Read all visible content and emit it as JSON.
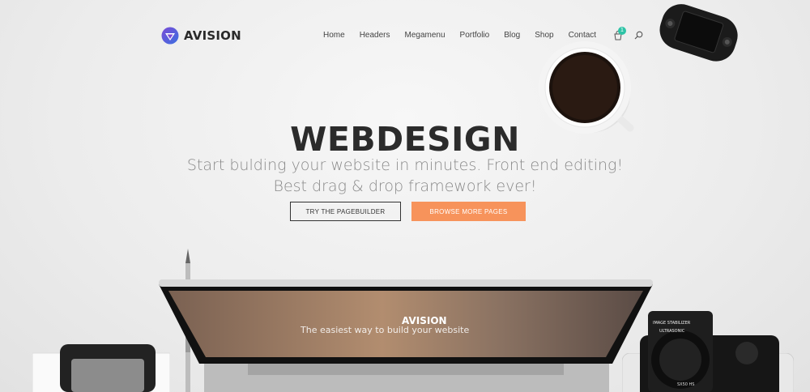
{
  "brand": {
    "name": "AVISION"
  },
  "nav": {
    "items": [
      "Home",
      "Headers",
      "Megamenu",
      "Portfolio",
      "Blog",
      "Shop",
      "Contact"
    ]
  },
  "cart": {
    "count": "1"
  },
  "hero": {
    "title": "WEBDESIGN",
    "subtitle_line1": "Start bulding your website in minutes. Front end editing!",
    "subtitle_line2": "Best drag & drop framework ever!",
    "primary_button": "TRY THE PAGEBUILDER",
    "secondary_button": "BROWSE MORE PAGES"
  },
  "laptop_screen": {
    "brand": "AVISION",
    "tagline": "The easiest way to build your website"
  },
  "camera_label": {
    "line1": "IMAGE STABILIZER",
    "line2": "ULTRASONIC",
    "line3": "SX50 HS"
  },
  "colors": {
    "accent": "#f7935b",
    "badge": "#2ec3a6",
    "text": "#2b2b2b",
    "muted": "#8a8a8a"
  },
  "icons": {
    "cart": "cart-icon",
    "search": "search-icon",
    "logo": "logo-diamond-icon"
  }
}
